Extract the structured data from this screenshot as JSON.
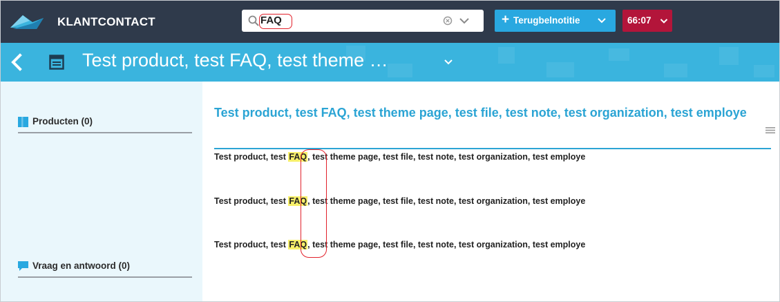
{
  "app": {
    "brand": "KLANTCONTACT",
    "logo_icon": "cloud-logo-icon"
  },
  "search": {
    "value": "FAQ",
    "icons": [
      "search-icon",
      "clear-icon",
      "chevron-down-icon"
    ]
  },
  "toolbar": {
    "callback_plus": "+",
    "callback_label": "Terugbelnotitie",
    "timer_label": "66:07"
  },
  "header": {
    "title": "Test product, test FAQ, test theme …",
    "icons": [
      "back-arrow-icon",
      "page-layout-icon",
      "chevron-down-icon"
    ]
  },
  "sidebar": {
    "sections": [
      {
        "label": "Producten (0)",
        "icon": "bookmark-icon"
      },
      {
        "label": "Vraag en antwoord (0)",
        "icon": "speech-bubble-icon"
      }
    ]
  },
  "main": {
    "heading": "Test product, test FAQ, test theme page, test file, test note, test organization, test employe",
    "results": [
      {
        "before": "Test product, test ",
        "highlight": "FAQ",
        "after": ", test theme page, test file, test note, test organization, test employe"
      },
      {
        "before": "Test product, test ",
        "highlight": "FAQ",
        "after": ", test theme page, test file, test note, test organization, test employe"
      },
      {
        "before": "Test product, test ",
        "highlight": "FAQ",
        "after": ", test theme page, test file, test note, test organization, test employe"
      }
    ]
  },
  "colors": {
    "topbar": "#2f3a4b",
    "accent_blue": "#3ab4de",
    "heading_blue": "#2ba4d4",
    "timer_red": "#b3153a",
    "highlight_yellow": "#f7f06a",
    "annotation_red": "#e2202a",
    "sidebar_bg": "#eaf7fc"
  }
}
